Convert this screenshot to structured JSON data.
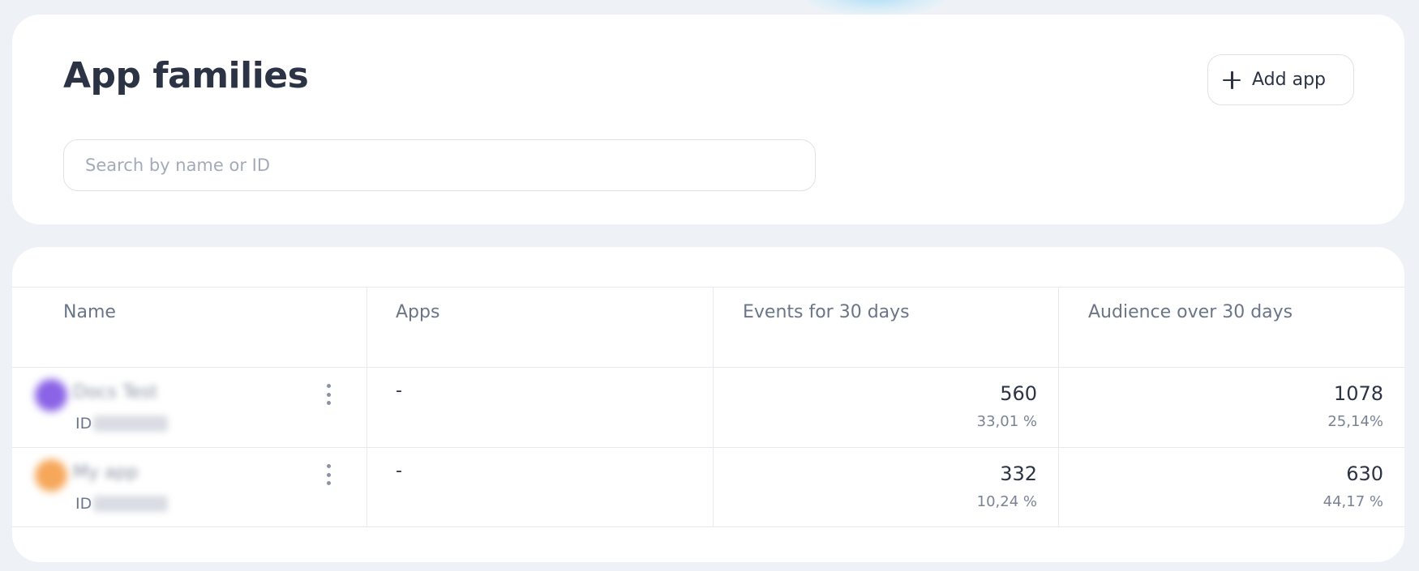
{
  "header": {
    "title": "App families",
    "add_button_label": "Add app",
    "search_placeholder": "Search by name or ID"
  },
  "table": {
    "columns": [
      "Name",
      "Apps",
      "Events for 30 days",
      "Audience over 30 days"
    ],
    "rows": [
      {
        "name": "Docs Test",
        "id_label": "ID",
        "id_value": "000000",
        "icon_color": "#8a63e6",
        "apps": "-",
        "events": "560",
        "events_pct": "33,01 %",
        "audience": "1078",
        "audience_pct": "25,14%"
      },
      {
        "name": "My app",
        "id_label": "ID",
        "id_value": "000000",
        "icon_color": "#f6a75a",
        "apps": "-",
        "events": "332",
        "events_pct": "10,24 %",
        "audience": "630",
        "audience_pct": "44,17 %"
      }
    ]
  },
  "colors": {
    "background": "#eef2f7",
    "card": "#ffffff",
    "text_primary": "#2b3345",
    "text_secondary": "#6b7588",
    "border": "#e6e9ee"
  },
  "icons": {
    "add": "plus-icon",
    "row_menu": "kebab-menu-icon"
  }
}
